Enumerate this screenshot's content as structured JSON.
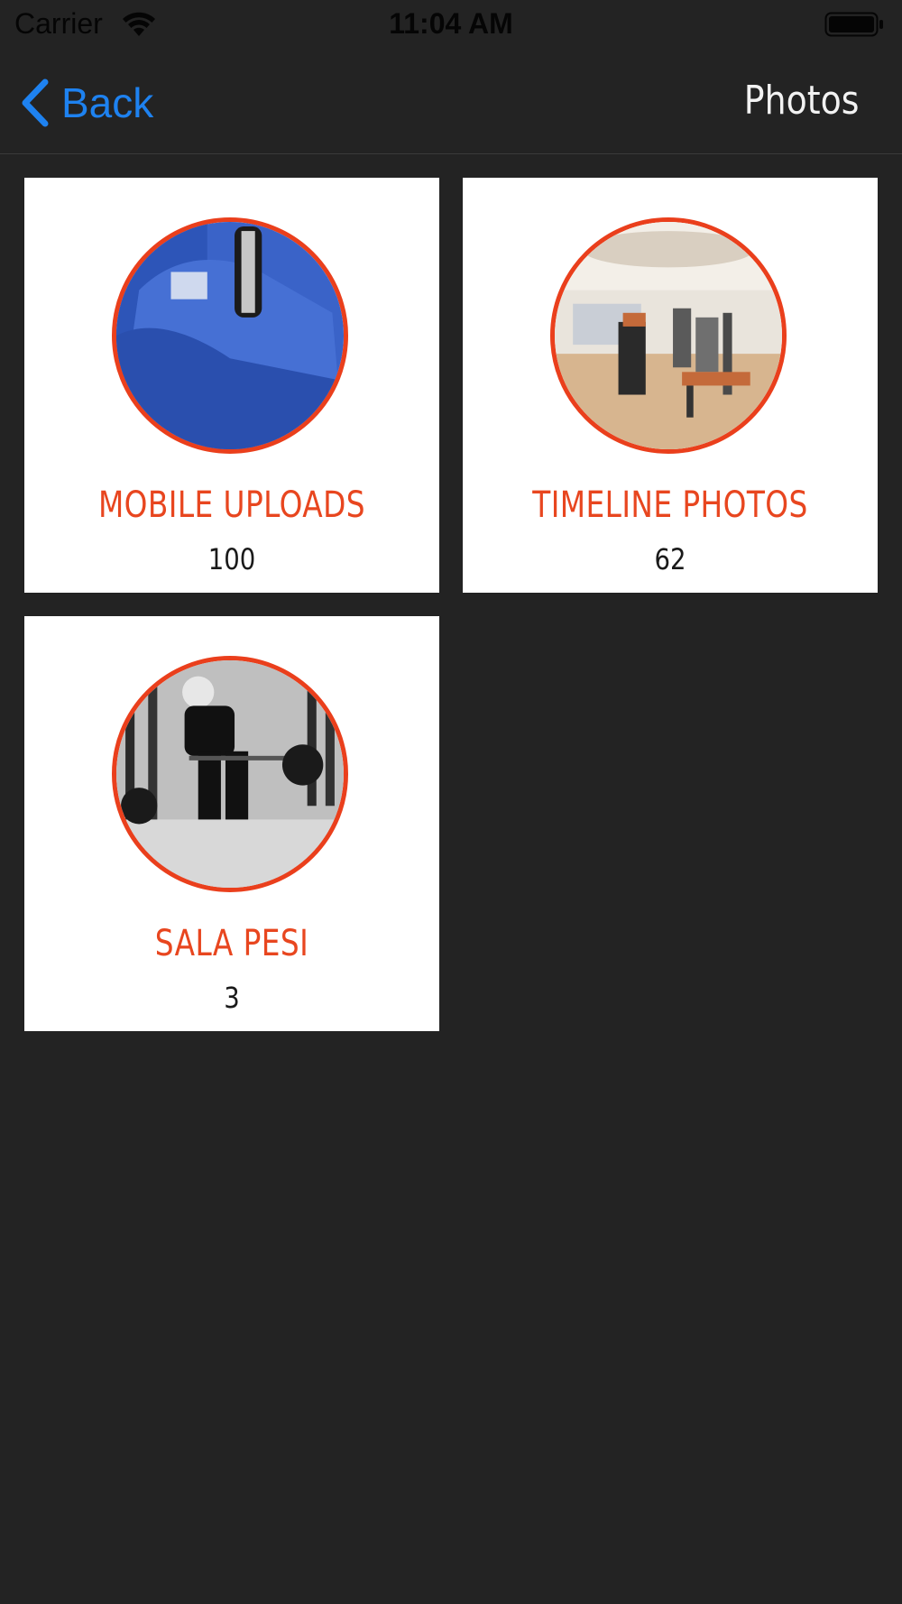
{
  "status_bar": {
    "carrier": "Carrier",
    "time": "11:04 AM",
    "wifi_icon": "wifi-icon",
    "battery_icon": "battery-icon"
  },
  "nav": {
    "back_label": "Back",
    "back_icon": "chevron-left-icon",
    "title": "Photos"
  },
  "colors": {
    "background": "#232323",
    "accent": "#e8461f",
    "link": "#1e82f0",
    "card": "#ffffff"
  },
  "albums": [
    {
      "title": "MOBILE UPLOADS",
      "count": "100"
    },
    {
      "title": "TIMELINE PHOTOS",
      "count": "62"
    },
    {
      "title": "SALA PESI",
      "count": "3"
    }
  ]
}
